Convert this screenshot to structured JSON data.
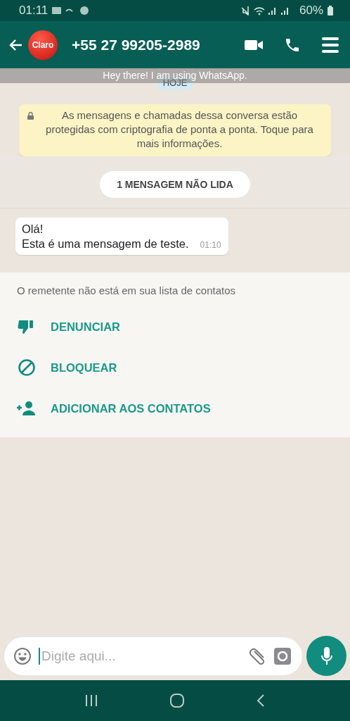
{
  "status_bar": {
    "time": "01:11",
    "battery": "60%"
  },
  "header": {
    "avatar_label": "Claro",
    "contact_name": "+55 27 99205-2989"
  },
  "status_text": "Hey there! I am using WhatsApp.",
  "date_chip": "HOJE",
  "encryption_notice": "As mensagens e chamadas dessa conversa estão protegidas com criptografia de ponta a ponta. Toque para mais informações.",
  "unread_banner": "1 MENSAGEM NÃO LIDA",
  "messages": [
    {
      "lines": [
        "Olá!",
        "Esta é uma mensagem de teste."
      ],
      "time": "01:10",
      "incoming": true
    }
  ],
  "contact_prompt": {
    "text": "O remetente não está em sua lista de contatos",
    "actions": [
      {
        "kind": "report",
        "label": "DENUNCIAR"
      },
      {
        "kind": "block",
        "label": "BLOQUEAR"
      },
      {
        "kind": "add",
        "label": "ADICIONAR AOS CONTATOS"
      }
    ]
  },
  "composer": {
    "placeholder": "Digite aqui..."
  }
}
